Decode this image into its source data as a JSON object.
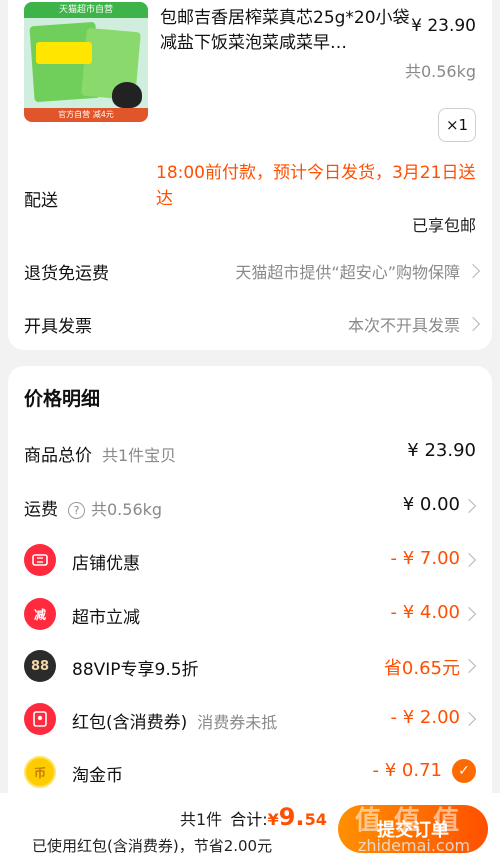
{
  "product": {
    "image_banner": "天猫超市自营",
    "image_bottom": "官方自营 减4元",
    "title": "包邮吉香居榨菜真芯25g*20小袋减盐下饭菜泡菜咸菜早…",
    "price": "¥ 23.90",
    "weight": "共0.56kg",
    "quantity": "×1"
  },
  "delivery": {
    "label": "配送",
    "text": "18:00前付款，预计今日发货，3月21日送达",
    "free_shipping": "已享包邮"
  },
  "return": {
    "label": "退货免运费",
    "value": "天猫超市提供“超安心”购物保障"
  },
  "invoice": {
    "label": "开具发票",
    "value": "本次不开具发票"
  },
  "price_detail": {
    "title": "价格明细",
    "goods_total": {
      "label": "商品总价",
      "sub": "共1件宝贝",
      "value": "¥ 23.90"
    },
    "shipping": {
      "label": "运费",
      "sub": "共0.56kg",
      "value": "¥ 0.00"
    },
    "store_discount": {
      "label": "店铺优惠",
      "value": "- ¥ 7.00",
      "icon": "coupon-icon",
      "icon_color": "#ff2a3d"
    },
    "market_discount": {
      "label": "超市立减",
      "value": "- ¥ 4.00",
      "icon": "reduce-icon",
      "icon_glyph": "减",
      "icon_color": "#ff2a3d"
    },
    "vip": {
      "label": "88VIP专享9.5折",
      "value": "省0.65元",
      "icon": "vip-88-icon",
      "icon_glyph": "88",
      "icon_color": "#2b2b2b"
    },
    "red_packet": {
      "label": "红包(含消费券)",
      "sub": "消费券未抵",
      "value": "- ¥ 2.00",
      "icon": "red-packet-icon",
      "icon_color": "#ff2a3d"
    },
    "taojinbi": {
      "label": "淘金币",
      "value": "- ¥ 0.71",
      "icon": "gold-coin-icon",
      "icon_glyph": "币",
      "icon_color": "#ffcc00",
      "checked": true
    }
  },
  "footer": {
    "count": "共1件",
    "total_label": "合计:",
    "currency": "¥",
    "total_main": "9.",
    "total_decimal": "54",
    "used_note": "已使用红包(含消费券)，节省2.00元",
    "submit": "提交订单"
  },
  "watermark": {
    "main": "值 值 值",
    "site": "zhidemai.com"
  },
  "colors": {
    "accent": "#ff4f00",
    "button_start": "#ff9000",
    "button_end": "#ff5000"
  }
}
